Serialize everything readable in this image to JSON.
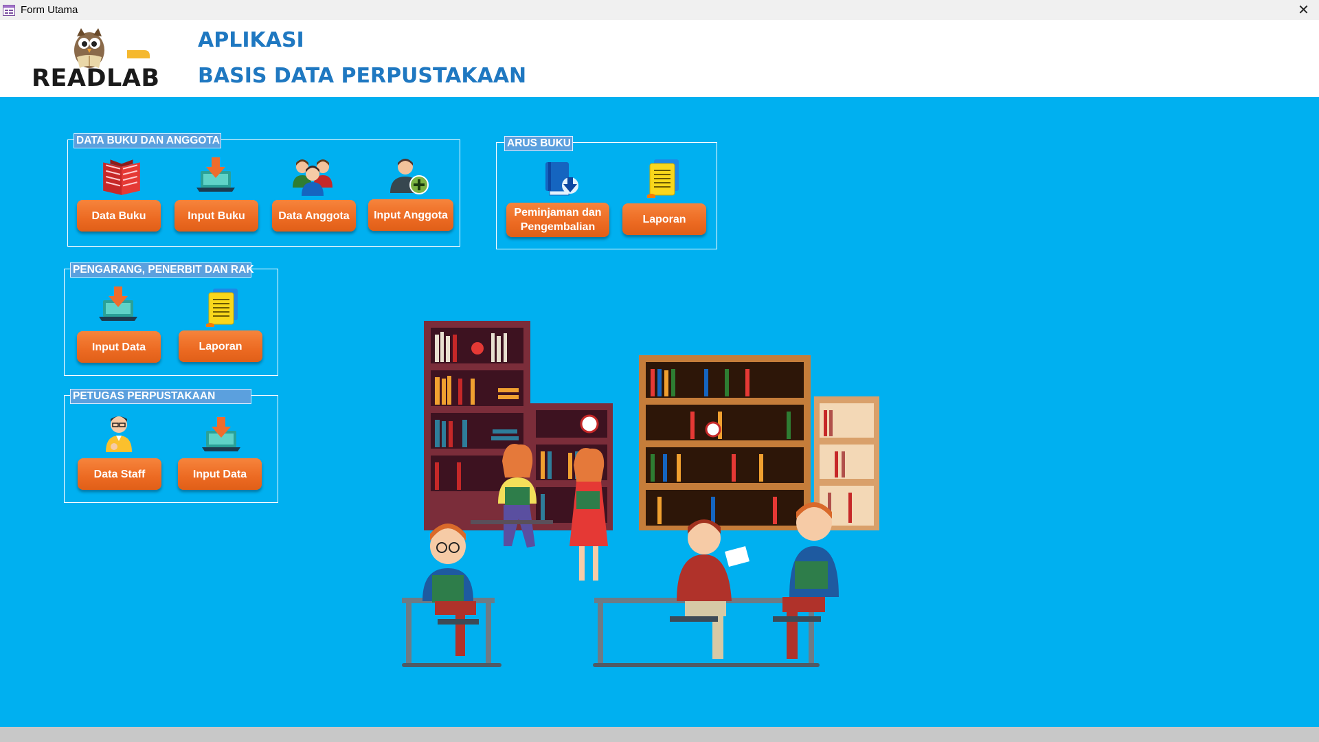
{
  "window": {
    "title": "Form Utama",
    "close_glyph": "✕"
  },
  "header": {
    "logo_text": "READLAB",
    "title_line1": "APLIKASI",
    "title_line2": "BASIS DATA PERPUSTAKAAN",
    "title_color": "#1f78c1"
  },
  "colors": {
    "background": "#00b0f0",
    "button": "#ec6a22",
    "group_label": "#5ba0de"
  },
  "groups": {
    "data_buku": {
      "label": "DATA BUKU DAN ANGGOTA",
      "buttons": [
        {
          "label": "Data Buku",
          "icon": "book-icon"
        },
        {
          "label": "Input Buku",
          "icon": "laptop-download-icon"
        },
        {
          "label": "Data Anggota",
          "icon": "people-group-icon"
        },
        {
          "label": "Input Anggota",
          "icon": "add-user-icon"
        }
      ]
    },
    "arus_buku": {
      "label": "ARUS BUKU",
      "buttons": [
        {
          "label_line1": "Peminjaman dan",
          "label_line2": "Pengembalian",
          "icon": "book-download-icon"
        },
        {
          "label": "Laporan",
          "icon": "report-document-icon"
        }
      ]
    },
    "pengarang": {
      "label": "PENGARANG, PENERBIT DAN RAK",
      "buttons": [
        {
          "label": "Input Data",
          "icon": "laptop-download-icon"
        },
        {
          "label": "Laporan",
          "icon": "report-document-icon"
        }
      ]
    },
    "petugas": {
      "label": "PETUGAS PERPUSTAKAAN",
      "buttons": [
        {
          "label": "Data Staff",
          "icon": "staff-person-icon"
        },
        {
          "label": "Input Data",
          "icon": "laptop-download-icon"
        }
      ]
    }
  }
}
